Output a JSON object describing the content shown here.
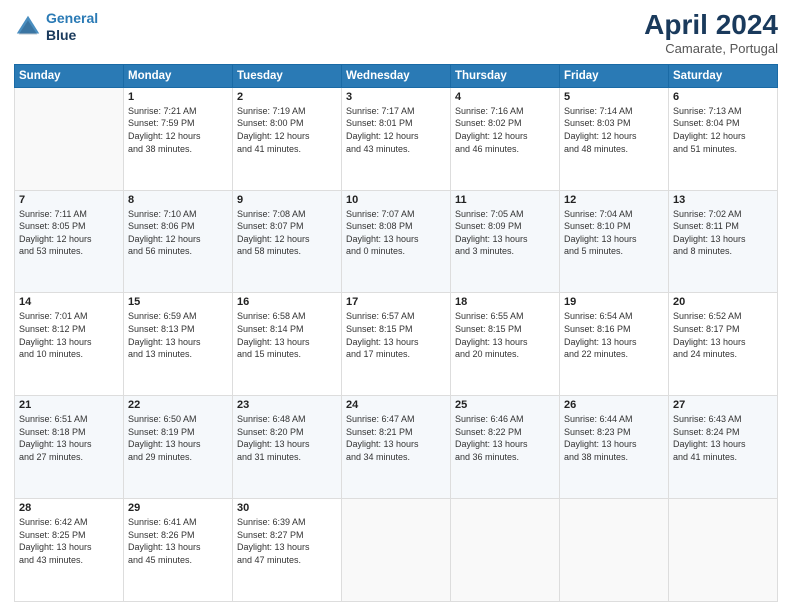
{
  "header": {
    "logo_line1": "General",
    "logo_line2": "Blue",
    "month_title": "April 2024",
    "location": "Camarate, Portugal"
  },
  "days_of_week": [
    "Sunday",
    "Monday",
    "Tuesday",
    "Wednesday",
    "Thursday",
    "Friday",
    "Saturday"
  ],
  "weeks": [
    [
      {
        "day": "",
        "info": ""
      },
      {
        "day": "1",
        "info": "Sunrise: 7:21 AM\nSunset: 7:59 PM\nDaylight: 12 hours\nand 38 minutes."
      },
      {
        "day": "2",
        "info": "Sunrise: 7:19 AM\nSunset: 8:00 PM\nDaylight: 12 hours\nand 41 minutes."
      },
      {
        "day": "3",
        "info": "Sunrise: 7:17 AM\nSunset: 8:01 PM\nDaylight: 12 hours\nand 43 minutes."
      },
      {
        "day": "4",
        "info": "Sunrise: 7:16 AM\nSunset: 8:02 PM\nDaylight: 12 hours\nand 46 minutes."
      },
      {
        "day": "5",
        "info": "Sunrise: 7:14 AM\nSunset: 8:03 PM\nDaylight: 12 hours\nand 48 minutes."
      },
      {
        "day": "6",
        "info": "Sunrise: 7:13 AM\nSunset: 8:04 PM\nDaylight: 12 hours\nand 51 minutes."
      }
    ],
    [
      {
        "day": "7",
        "info": "Sunrise: 7:11 AM\nSunset: 8:05 PM\nDaylight: 12 hours\nand 53 minutes."
      },
      {
        "day": "8",
        "info": "Sunrise: 7:10 AM\nSunset: 8:06 PM\nDaylight: 12 hours\nand 56 minutes."
      },
      {
        "day": "9",
        "info": "Sunrise: 7:08 AM\nSunset: 8:07 PM\nDaylight: 12 hours\nand 58 minutes."
      },
      {
        "day": "10",
        "info": "Sunrise: 7:07 AM\nSunset: 8:08 PM\nDaylight: 13 hours\nand 0 minutes."
      },
      {
        "day": "11",
        "info": "Sunrise: 7:05 AM\nSunset: 8:09 PM\nDaylight: 13 hours\nand 3 minutes."
      },
      {
        "day": "12",
        "info": "Sunrise: 7:04 AM\nSunset: 8:10 PM\nDaylight: 13 hours\nand 5 minutes."
      },
      {
        "day": "13",
        "info": "Sunrise: 7:02 AM\nSunset: 8:11 PM\nDaylight: 13 hours\nand 8 minutes."
      }
    ],
    [
      {
        "day": "14",
        "info": "Sunrise: 7:01 AM\nSunset: 8:12 PM\nDaylight: 13 hours\nand 10 minutes."
      },
      {
        "day": "15",
        "info": "Sunrise: 6:59 AM\nSunset: 8:13 PM\nDaylight: 13 hours\nand 13 minutes."
      },
      {
        "day": "16",
        "info": "Sunrise: 6:58 AM\nSunset: 8:14 PM\nDaylight: 13 hours\nand 15 minutes."
      },
      {
        "day": "17",
        "info": "Sunrise: 6:57 AM\nSunset: 8:15 PM\nDaylight: 13 hours\nand 17 minutes."
      },
      {
        "day": "18",
        "info": "Sunrise: 6:55 AM\nSunset: 8:15 PM\nDaylight: 13 hours\nand 20 minutes."
      },
      {
        "day": "19",
        "info": "Sunrise: 6:54 AM\nSunset: 8:16 PM\nDaylight: 13 hours\nand 22 minutes."
      },
      {
        "day": "20",
        "info": "Sunrise: 6:52 AM\nSunset: 8:17 PM\nDaylight: 13 hours\nand 24 minutes."
      }
    ],
    [
      {
        "day": "21",
        "info": "Sunrise: 6:51 AM\nSunset: 8:18 PM\nDaylight: 13 hours\nand 27 minutes."
      },
      {
        "day": "22",
        "info": "Sunrise: 6:50 AM\nSunset: 8:19 PM\nDaylight: 13 hours\nand 29 minutes."
      },
      {
        "day": "23",
        "info": "Sunrise: 6:48 AM\nSunset: 8:20 PM\nDaylight: 13 hours\nand 31 minutes."
      },
      {
        "day": "24",
        "info": "Sunrise: 6:47 AM\nSunset: 8:21 PM\nDaylight: 13 hours\nand 34 minutes."
      },
      {
        "day": "25",
        "info": "Sunrise: 6:46 AM\nSunset: 8:22 PM\nDaylight: 13 hours\nand 36 minutes."
      },
      {
        "day": "26",
        "info": "Sunrise: 6:44 AM\nSunset: 8:23 PM\nDaylight: 13 hours\nand 38 minutes."
      },
      {
        "day": "27",
        "info": "Sunrise: 6:43 AM\nSunset: 8:24 PM\nDaylight: 13 hours\nand 41 minutes."
      }
    ],
    [
      {
        "day": "28",
        "info": "Sunrise: 6:42 AM\nSunset: 8:25 PM\nDaylight: 13 hours\nand 43 minutes."
      },
      {
        "day": "29",
        "info": "Sunrise: 6:41 AM\nSunset: 8:26 PM\nDaylight: 13 hours\nand 45 minutes."
      },
      {
        "day": "30",
        "info": "Sunrise: 6:39 AM\nSunset: 8:27 PM\nDaylight: 13 hours\nand 47 minutes."
      },
      {
        "day": "",
        "info": ""
      },
      {
        "day": "",
        "info": ""
      },
      {
        "day": "",
        "info": ""
      },
      {
        "day": "",
        "info": ""
      }
    ]
  ]
}
